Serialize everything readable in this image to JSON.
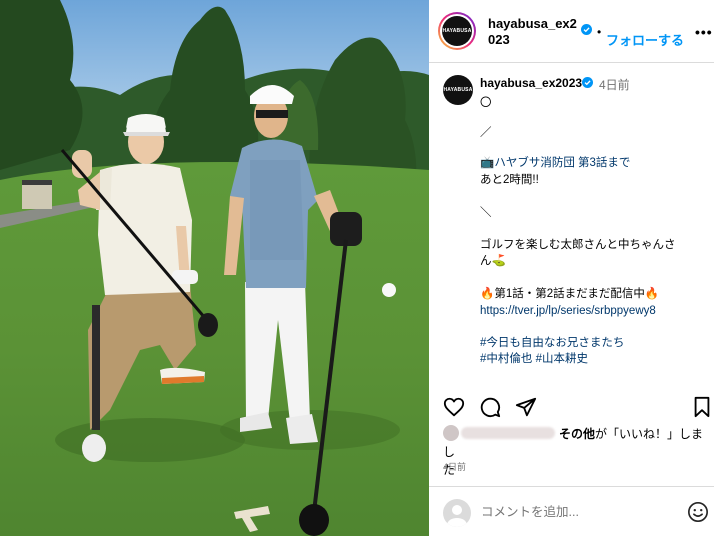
{
  "header": {
    "username": "hayabusa_ex2023",
    "avatar_text": "HAYABUSA",
    "separator": "•",
    "follow_label": "フォローする",
    "more_label": "•••"
  },
  "caption": {
    "username": "hayabusa_ex2023",
    "time_ago": "4日前",
    "lines": [
      "〇",
      "／",
      "📺ハヤブサ消防団 第3話まで",
      "あと2時間!!",
      "＼",
      "ゴルフを楽しむ太郎さんと中ちゃんさ",
      "ん⛳",
      "🔥第1話・第2話まだまだ配信中🔥"
    ],
    "link": "https://tver.jp/lp/series/srbppyewy8",
    "hashtags": [
      "#今日も自由なお兄さまたち",
      "#中村倫也",
      "#山本耕史"
    ]
  },
  "likes": {
    "text_bold": "その他",
    "text_rest_1": "が「いいね！」しまし",
    "text_rest_2": "た"
  },
  "post_date": "4日前",
  "comment": {
    "placeholder": "コメントを追加..."
  },
  "colors": {
    "accent": "#0095f6",
    "link": "#00376b",
    "secondary_text": "#737373",
    "divider": "#dbdbdb"
  },
  "icons": {
    "verified": "verified-badge-icon",
    "like": "heart-icon",
    "comment": "speech-bubble-icon",
    "share": "paper-plane-icon",
    "save": "bookmark-icon",
    "emoji": "smiley-icon"
  }
}
